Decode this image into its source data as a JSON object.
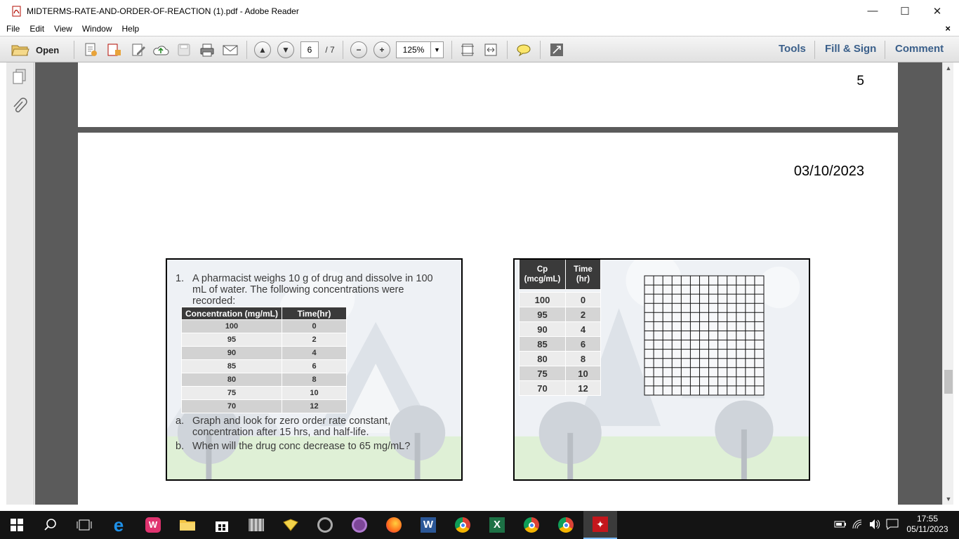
{
  "window": {
    "title": "MIDTERMS-RATE-AND-ORDER-OF-REACTION (1).pdf - Adobe Reader",
    "minimize": "—",
    "maximize": "☐",
    "close": "✕"
  },
  "menu": {
    "items": [
      "File",
      "Edit",
      "View",
      "Window",
      "Help"
    ],
    "close": "×"
  },
  "toolbar": {
    "open_label": "Open",
    "page_current": "6",
    "page_total": "/ 7",
    "zoom": "125%",
    "tools": "Tools",
    "fill_sign": "Fill & Sign",
    "comment": "Comment"
  },
  "document": {
    "page5_number": "5",
    "page6_date": "03/10/2023",
    "slide1": {
      "q_num": "1.",
      "q_text_lines": [
        "A pharmacist weighs 10 g of drug and dissolve in 100",
        "mL of water. The following concentrations were",
        "recorded:"
      ],
      "headers": [
        "Concentration (mg/mL)",
        "Time(hr)"
      ],
      "rows": [
        [
          "100",
          "0"
        ],
        [
          "95",
          "2"
        ],
        [
          "90",
          "4"
        ],
        [
          "85",
          "6"
        ],
        [
          "80",
          "8"
        ],
        [
          "75",
          "10"
        ],
        [
          "70",
          "12"
        ]
      ],
      "a_label": "a.",
      "a_lines": [
        "Graph and look for zero order rate constant,",
        "concentration after 15 hrs, and half-life."
      ],
      "b_label": "b.",
      "b_text": "When will the drug conc decrease to 65 mg/mL?"
    },
    "slide2": {
      "headers": [
        [
          "Cp",
          "(mcg/mL)"
        ],
        [
          "Time",
          "(hr)"
        ]
      ],
      "rows": [
        [
          "100",
          "0"
        ],
        [
          "95",
          "2"
        ],
        [
          "90",
          "4"
        ],
        [
          "85",
          "6"
        ],
        [
          "80",
          "8"
        ],
        [
          "75",
          "10"
        ],
        [
          "70",
          "12"
        ]
      ]
    }
  },
  "taskbar": {
    "time": "17:55",
    "date": "05/11/2023",
    "apps": [
      "start-icon",
      "search-icon",
      "task-view-icon",
      "edge-icon",
      "wps-icon",
      "file-explorer-icon",
      "store-icon",
      "app-icon",
      "folder-icon",
      "app-icon-2",
      "tor-icon",
      "firefox-icon",
      "word-icon",
      "chrome-icon",
      "excel-icon",
      "chrome-icon-2",
      "chrome-icon-3",
      "acrobat-icon"
    ]
  }
}
